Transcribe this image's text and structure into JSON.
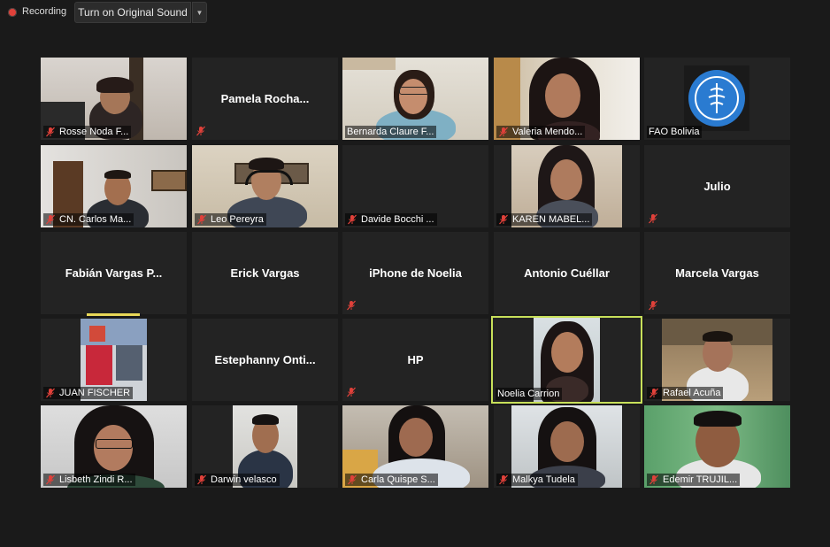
{
  "topbar": {
    "recording_label": "Recording",
    "sound_button_label": "Turn on Original Sound",
    "dropdown_icon": "chevron-down-icon"
  },
  "colors": {
    "background": "#1a1a1a",
    "tile": "#232323",
    "active_speaker_border": "#c8e05a",
    "recording_dot": "#e0413a",
    "muted_icon": "#e0413a"
  },
  "participants": [
    {
      "name": "Rosse Noda F...",
      "muted": true,
      "video": true
    },
    {
      "name": "Pamela  Rocha...",
      "muted": true,
      "video": false
    },
    {
      "name": "Bernarda Claure F...",
      "muted": false,
      "video": true
    },
    {
      "name": "Valeria Mendo...",
      "muted": true,
      "video": true
    },
    {
      "name": "FAO Bolivia",
      "muted": false,
      "video": true
    },
    {
      "name": "CN. Carlos Ma...",
      "muted": true,
      "video": true
    },
    {
      "name": "Leo Pereyra",
      "muted": true,
      "video": true
    },
    {
      "name": "Davide Bocchi ...",
      "muted": true,
      "video": false
    },
    {
      "name": "KAREN MABEL...",
      "muted": true,
      "video": true
    },
    {
      "name": "Julio",
      "muted": true,
      "video": false
    },
    {
      "name": "Fabián  Vargas  P...",
      "muted": false,
      "video": false
    },
    {
      "name": "Erick Vargas",
      "muted": false,
      "video": false
    },
    {
      "name": "iPhone de Noelia",
      "muted": true,
      "video": false
    },
    {
      "name": "Antonio Cuéllar",
      "muted": false,
      "video": false
    },
    {
      "name": "Marcela Vargas",
      "muted": true,
      "video": false
    },
    {
      "name": "JUAN FISCHER",
      "muted": true,
      "video": true
    },
    {
      "name": "Estephanny  Onti...",
      "muted": false,
      "video": false
    },
    {
      "name": "HP",
      "muted": true,
      "video": false
    },
    {
      "name": "Noelia Carrion",
      "muted": false,
      "video": true,
      "active_speaker": true
    },
    {
      "name": "Rafael Acuña",
      "muted": true,
      "video": true
    },
    {
      "name": "Lisbeth Zindi R...",
      "muted": true,
      "video": true
    },
    {
      "name": "Darwin velasco",
      "muted": true,
      "video": true
    },
    {
      "name": "Carla Quispe S...",
      "muted": true,
      "video": true
    },
    {
      "name": "Malkya Tudela",
      "muted": true,
      "video": true
    },
    {
      "name": "Edemir  TRUJIL...",
      "muted": true,
      "video": true
    }
  ]
}
